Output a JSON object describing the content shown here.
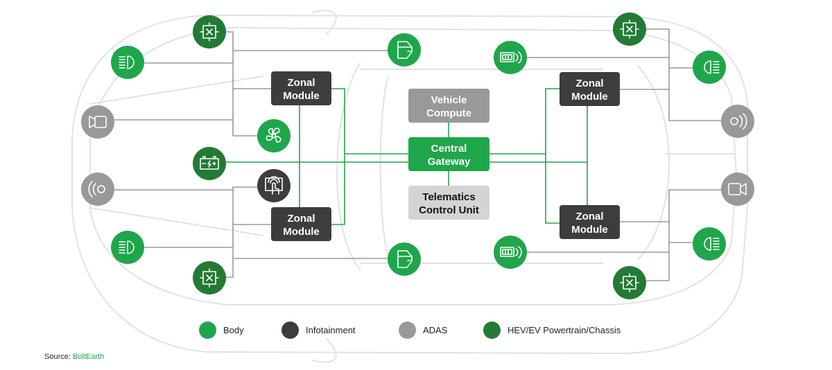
{
  "colors": {
    "body": "#1fa64a",
    "infotainment": "#3d3d3d",
    "adas": "#999999",
    "powertrain": "#237a35",
    "telematics": "#d4d4d4",
    "car_outline": "#e2e2e2"
  },
  "boxes": {
    "zonal_module": [
      "Zonal",
      "Module"
    ],
    "vehicle_compute": [
      "Vehicle",
      "Compute"
    ],
    "central_gateway": [
      "Central",
      "Gateway"
    ],
    "telematics": [
      "Telematics",
      "Control Unit"
    ]
  },
  "icons": {
    "chassis": "chassis-module-icon",
    "headlight": "headlight-icon",
    "camera": "camera-icon",
    "radar": "radar-icon",
    "fan": "fan-icon",
    "battery": "battery-icon",
    "touchscreen": "touchscreen-icon",
    "door": "door-icon",
    "window_sensor": "window-sensor-icon"
  },
  "legend": [
    {
      "label": "Body",
      "color": "#1fa64a"
    },
    {
      "label": "Infotainment",
      "color": "#3d3d3d"
    },
    {
      "label": "ADAS",
      "color": "#999999"
    },
    {
      "label": "HEV/EV Powertrain/Chassis",
      "color": "#237a35"
    }
  ],
  "source": {
    "prefix": "Source: ",
    "name": "BoltEarth"
  }
}
